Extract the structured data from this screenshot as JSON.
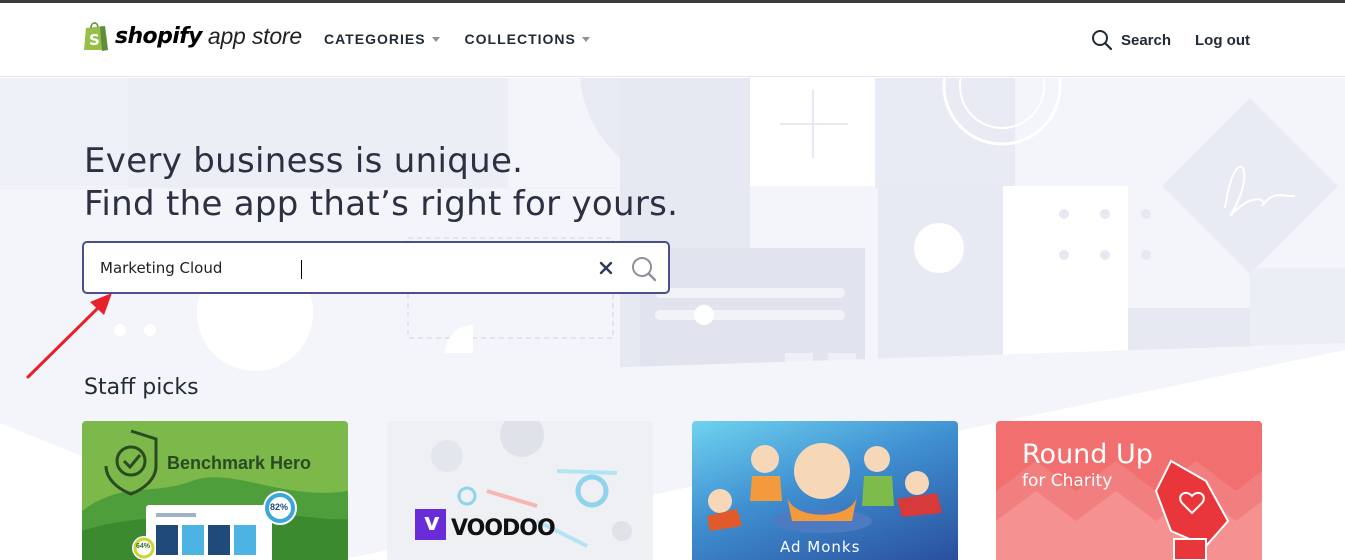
{
  "header": {
    "logo_word": "shopify",
    "logo_sub": "app store",
    "nav": [
      {
        "label": "CATEGORIES"
      },
      {
        "label": "COLLECTIONS"
      }
    ],
    "search_label": "Search",
    "logout_label": "Log out"
  },
  "hero": {
    "line1": "Every business is unique.",
    "line2": "Find the app that’s right for yours."
  },
  "search": {
    "value": "Marketing Cloud"
  },
  "staff_picks": {
    "heading": "Staff picks",
    "cards": [
      {
        "title": "Benchmark Hero",
        "badge_top": "82%",
        "badge_bottom": "64%"
      },
      {
        "title": "VOODOO",
        "logo_letter": "v"
      },
      {
        "title": "Ad Monks"
      },
      {
        "title": "Round Up",
        "subtitle": "for Charity"
      }
    ]
  },
  "colors": {
    "shopify_green": "#95bf47",
    "search_border": "#4a4f8b",
    "annotation_arrow": "#e8202a"
  },
  "icons": [
    "shopify-bag-icon",
    "search-icon",
    "clear-icon",
    "caret-down-icon"
  ]
}
